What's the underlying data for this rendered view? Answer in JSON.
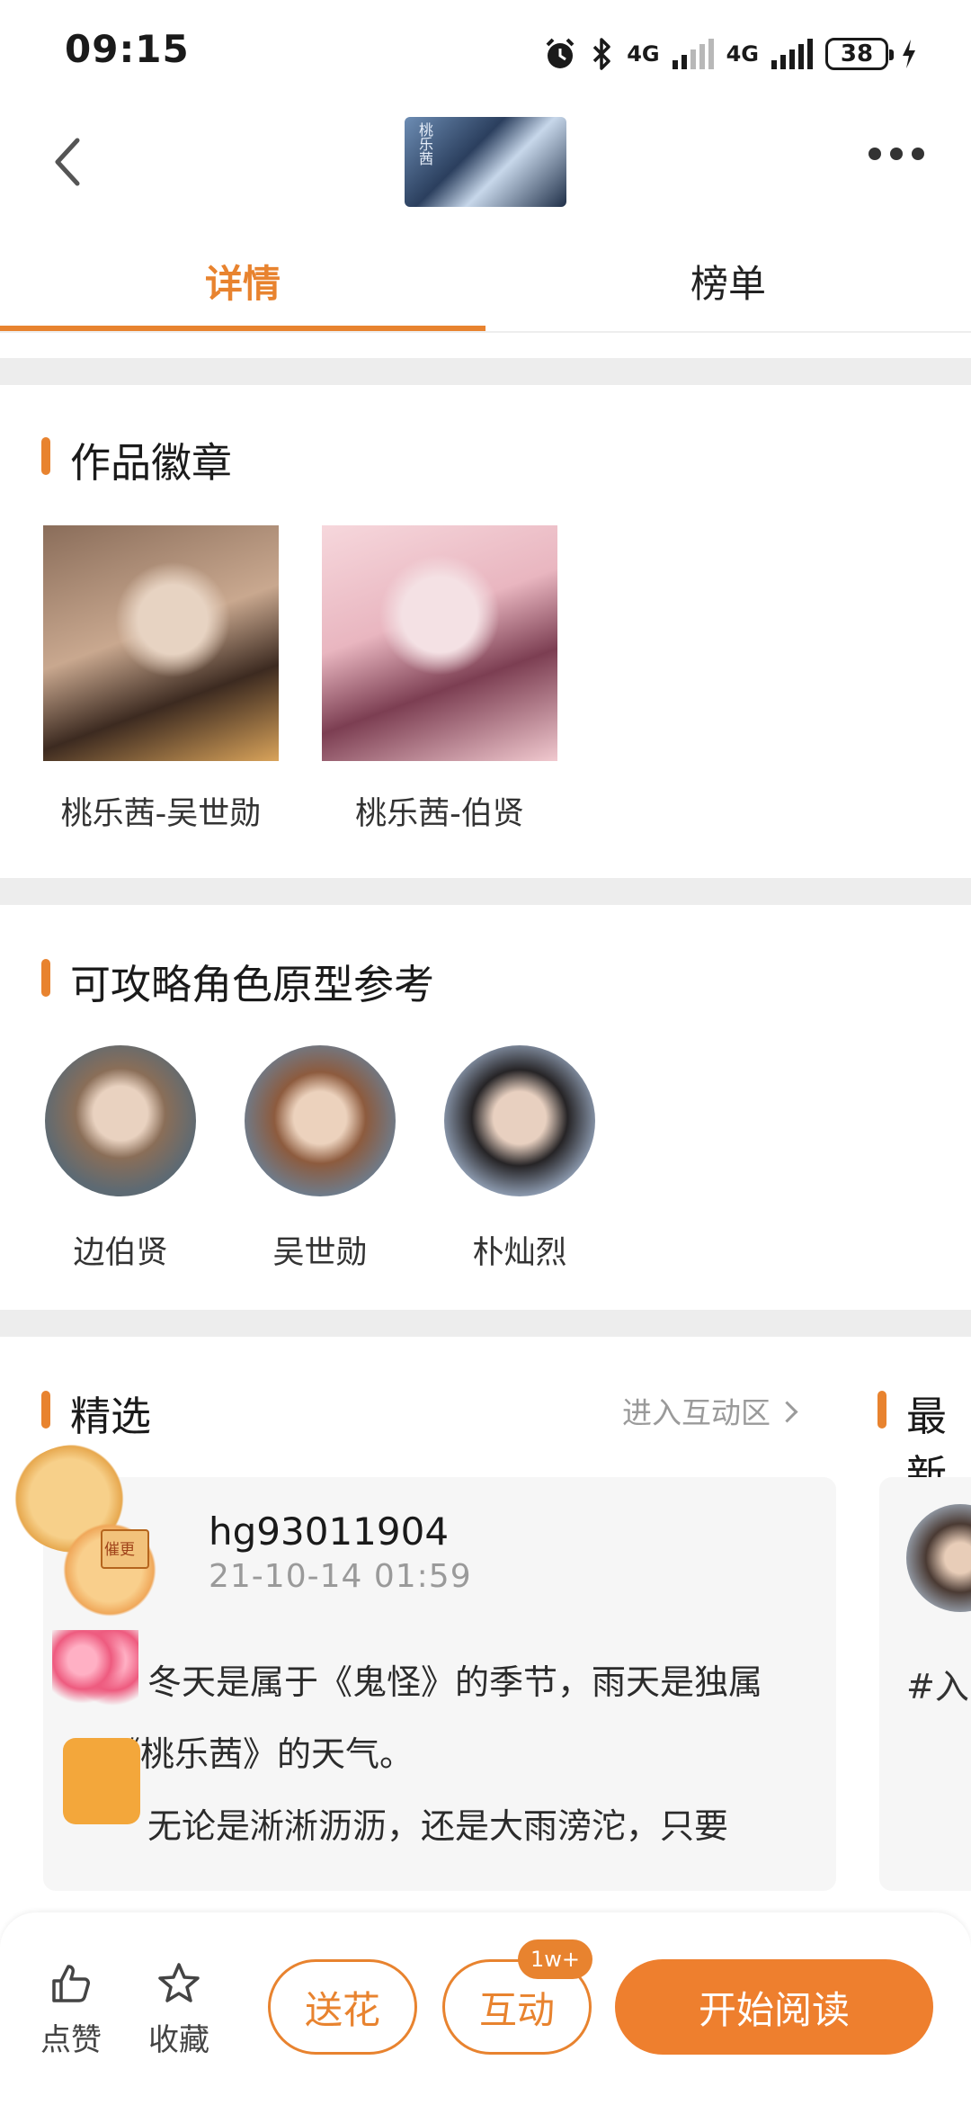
{
  "status_bar": {
    "time": "09:15",
    "network_1": "4G",
    "network_2": "4G",
    "battery": "38"
  },
  "header": {
    "cover_text": "桃乐茜",
    "tabs": [
      {
        "label": "详情",
        "active": true
      },
      {
        "label": "榜单",
        "active": false
      }
    ]
  },
  "badges_section": {
    "title": "作品徽章",
    "items": [
      {
        "label": "桃乐茜-吴世勋"
      },
      {
        "label": "桃乐茜-伯贤"
      }
    ]
  },
  "characters_section": {
    "title": "可攻略角色原型参考",
    "items": [
      {
        "name": "边伯贤"
      },
      {
        "name": "吴世勋"
      },
      {
        "name": "朴灿烈"
      }
    ]
  },
  "comments_section": {
    "title": "精选",
    "enter_link": "进入互动区",
    "side_title": "最新",
    "comment": {
      "user": "hg93011904",
      "time": "21-10-14 01:59",
      "line1": "冬天是属于《鬼怪》的季节，雨天是独属",
      "line2": "于《桃乐茜》的天气。",
      "line3": "无论是淅淅沥沥，还是大雨滂沱，只要"
    },
    "side_hashtag": "#入",
    "sticker_tag": "催更"
  },
  "bottom_bar": {
    "like_label": "点赞",
    "favorite_label": "收藏",
    "send_flower_label": "送花",
    "interact_label": "互动",
    "interact_count": "1w+",
    "start_reading_label": "开始阅读"
  },
  "colors": {
    "accent": "#e8832f",
    "divider": "#ededed",
    "card_bg": "#f6f6f6"
  }
}
